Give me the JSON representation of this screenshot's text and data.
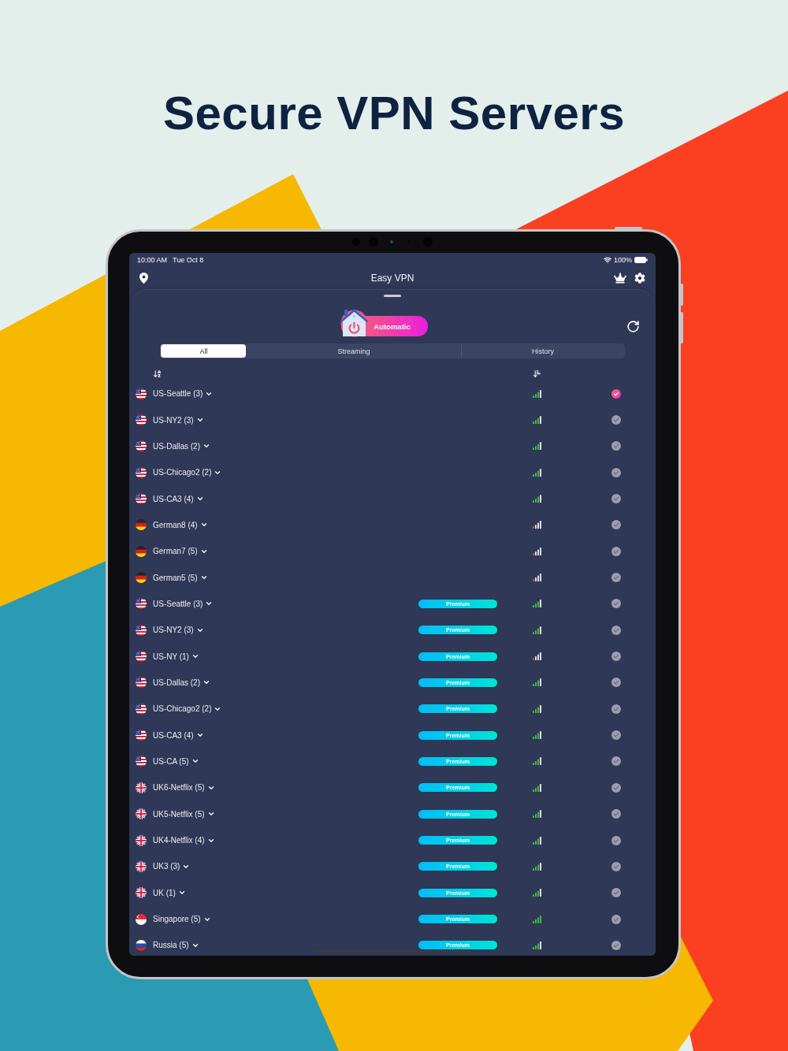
{
  "headline": "Secure VPN Servers",
  "status_bar": {
    "time": "10:00 AM",
    "date": "Tue Oct 8",
    "battery": "100%"
  },
  "nav": {
    "title": "Easy VPN"
  },
  "connect_button": {
    "label": "Automatic"
  },
  "tabs": [
    {
      "label": "All",
      "selected": true
    },
    {
      "label": "Streaming",
      "selected": false
    },
    {
      "label": "History",
      "selected": false
    }
  ],
  "servers": [
    {
      "kind": "us",
      "name": "US-Seattle (3)",
      "weak_signal": false,
      "full_signal": false,
      "selected": true
    },
    {
      "kind": "us",
      "name": "US-NY2 (3)",
      "weak_signal": false,
      "full_signal": false,
      "selected": false
    },
    {
      "kind": "us",
      "name": "US-Dallas (2)",
      "weak_signal": false,
      "full_signal": false,
      "selected": false
    },
    {
      "kind": "us",
      "name": "US-Chicago2 (2)",
      "weak_signal": false,
      "full_signal": false,
      "selected": false
    },
    {
      "kind": "us",
      "name": "US-CA3 (4)",
      "weak_signal": false,
      "full_signal": false,
      "selected": false
    },
    {
      "kind": "de",
      "name": "German8 (4)",
      "weak_signal": true,
      "full_signal": false,
      "selected": false
    },
    {
      "kind": "de",
      "name": "German7 (5)",
      "weak_signal": true,
      "full_signal": false,
      "selected": false
    },
    {
      "kind": "de",
      "name": "German5 (5)",
      "weak_signal": true,
      "full_signal": false,
      "selected": false
    },
    {
      "kind": "us",
      "name": "US-Seattle (3)",
      "badge": "Premium",
      "weak_signal": false,
      "full_signal": false,
      "selected": false
    },
    {
      "kind": "us",
      "name": "US-NY2 (3)",
      "badge": "Premium",
      "weak_signal": false,
      "full_signal": false,
      "selected": false
    },
    {
      "kind": "us",
      "name": "US-NY (1)",
      "badge": "Premium",
      "weak_signal": true,
      "full_signal": false,
      "selected": false
    },
    {
      "kind": "us",
      "name": "US-Dallas (2)",
      "badge": "Premium",
      "weak_signal": false,
      "full_signal": false,
      "selected": false
    },
    {
      "kind": "us",
      "name": "US-Chicago2 (2)",
      "badge": "Premium",
      "weak_signal": false,
      "full_signal": false,
      "selected": false
    },
    {
      "kind": "us",
      "name": "US-CA3 (4)",
      "badge": "Premium",
      "weak_signal": false,
      "full_signal": false,
      "selected": false
    },
    {
      "kind": "us",
      "name": "US-CA (5)",
      "badge": "Premium",
      "weak_signal": false,
      "full_signal": false,
      "selected": false
    },
    {
      "kind": "gb",
      "name": "UK6-Netflix (5)",
      "badge": "Premium",
      "weak_signal": false,
      "full_signal": false,
      "selected": false
    },
    {
      "kind": "gb",
      "name": "UK5-Netflix (5)",
      "badge": "Premium",
      "weak_signal": false,
      "full_signal": false,
      "selected": false
    },
    {
      "kind": "gb",
      "name": "UK4-Netflix (4)",
      "badge": "Premium",
      "weak_signal": false,
      "full_signal": false,
      "selected": false
    },
    {
      "kind": "gb",
      "name": "UK3 (3)",
      "badge": "Premium",
      "weak_signal": false,
      "full_signal": false,
      "selected": false
    },
    {
      "kind": "gb",
      "name": "UK (1)",
      "badge": "Premium",
      "weak_signal": false,
      "full_signal": false,
      "selected": false
    },
    {
      "kind": "sg",
      "name": "Singapore (5)",
      "badge": "Premium",
      "weak_signal": false,
      "full_signal": true,
      "selected": false
    },
    {
      "kind": "ru",
      "name": "Russia (5)",
      "badge": "Premium",
      "weak_signal": false,
      "full_signal": false,
      "selected": false
    }
  ]
}
